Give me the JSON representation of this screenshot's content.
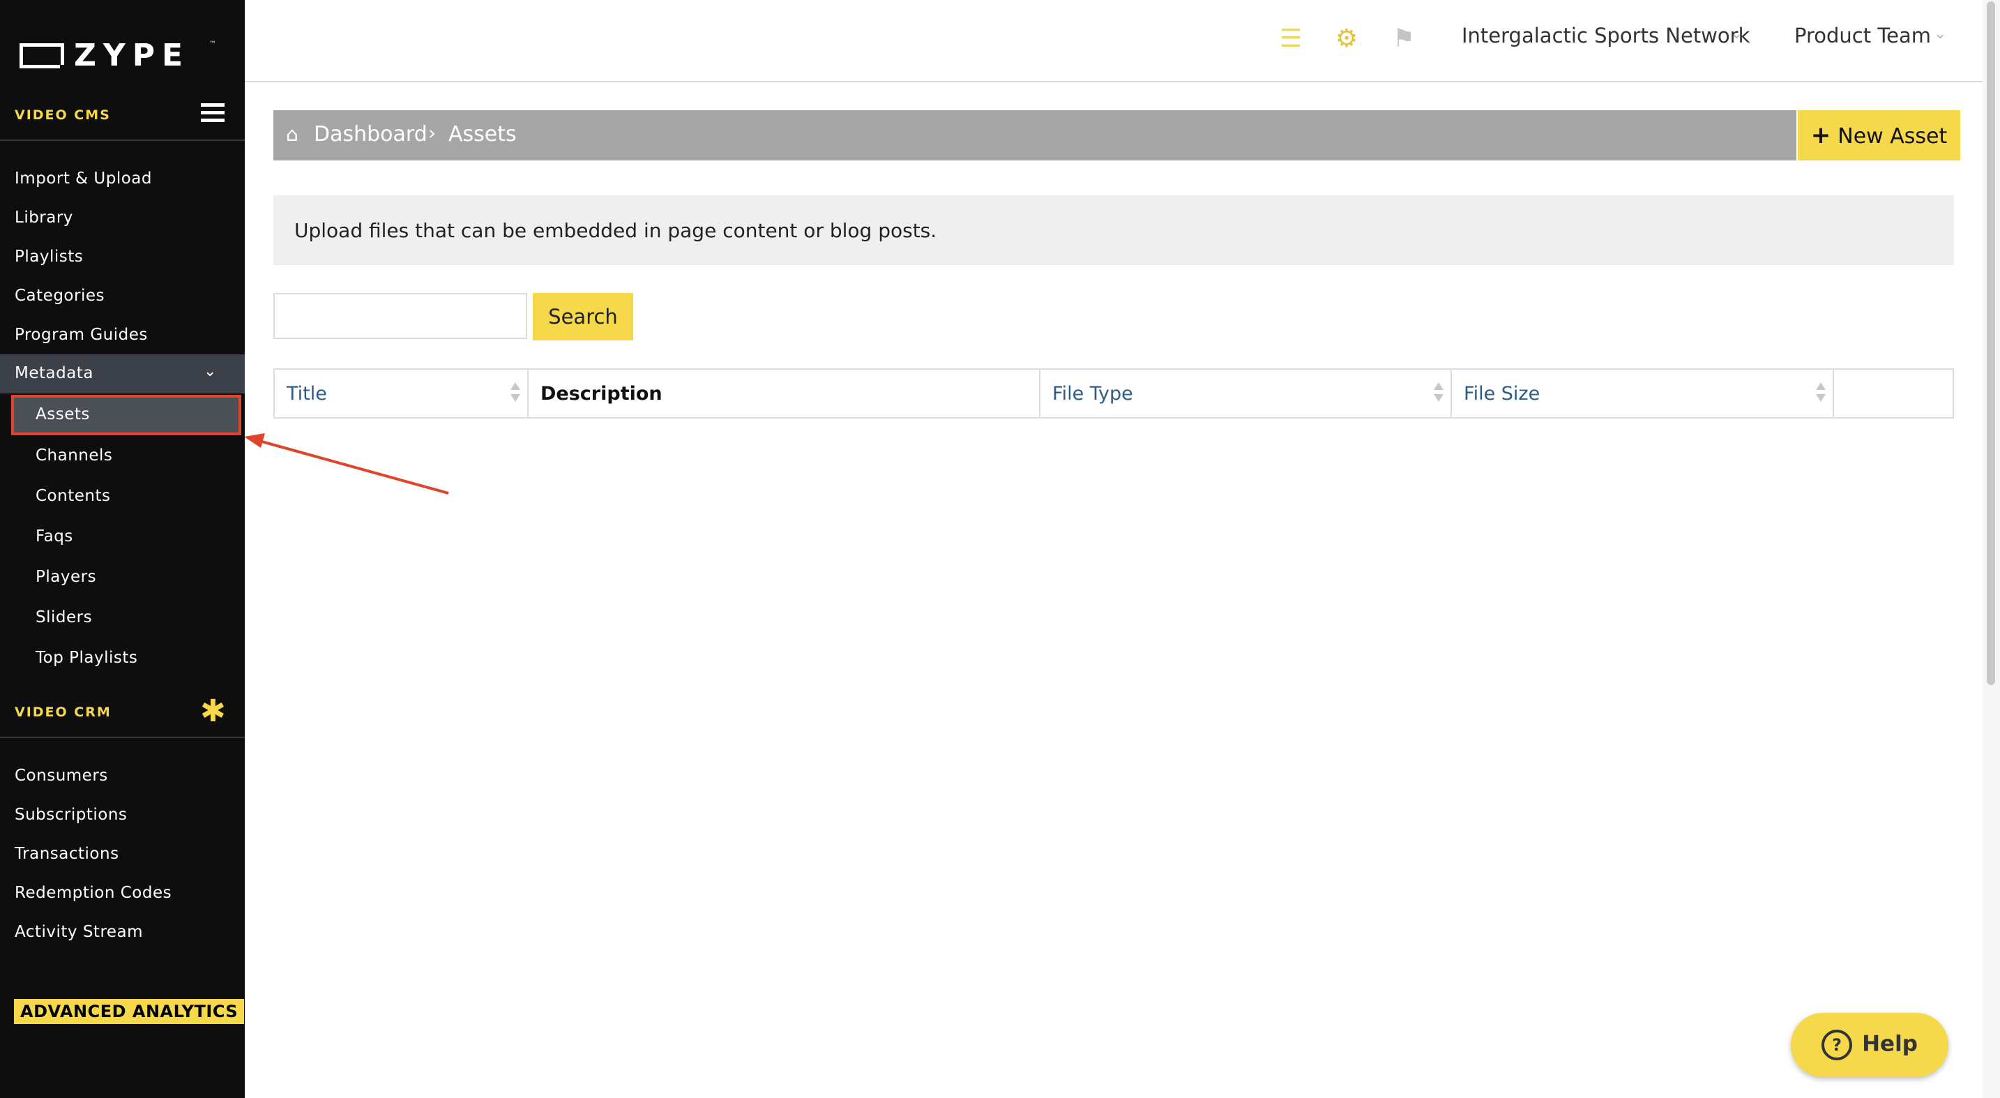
{
  "sidebar": {
    "logo": "ZYPE",
    "video_cms_title": "VIDEO CMS",
    "cms_items": [
      {
        "label": "Import & Upload"
      },
      {
        "label": "Library"
      },
      {
        "label": "Playlists"
      },
      {
        "label": "Categories"
      },
      {
        "label": "Program Guides"
      }
    ],
    "metadata_label": "Metadata",
    "metadata_items": [
      {
        "label": "Assets"
      },
      {
        "label": "Channels"
      },
      {
        "label": "Contents"
      },
      {
        "label": "Faqs"
      },
      {
        "label": "Players"
      },
      {
        "label": "Sliders"
      },
      {
        "label": "Top Playlists"
      }
    ],
    "video_crm_title": "VIDEO CRM",
    "crm_items": [
      {
        "label": "Consumers"
      },
      {
        "label": "Subscriptions"
      },
      {
        "label": "Transactions"
      },
      {
        "label": "Redemption Codes"
      },
      {
        "label": "Activity Stream"
      }
    ],
    "advanced_analytics": "ADVANCED ANALYTICS"
  },
  "header": {
    "org_name": "Intergalactic Sports Network",
    "team_name": "Product Team",
    "icons": [
      "stack-icon",
      "gears-icon",
      "chat-icon"
    ]
  },
  "breadcrumb": {
    "home": "Dashboard",
    "current": "Assets"
  },
  "new_asset_label": "New Asset",
  "info_text": "Upload files that can be embedded in page content or blog posts.",
  "search": {
    "button_label": "Search",
    "value": ""
  },
  "table": {
    "columns": [
      "Title",
      "Description",
      "File Type",
      "File Size",
      ""
    ]
  },
  "help_label": "Help",
  "colors": {
    "accent": "#f5d94a",
    "sidebar_bg": "#0e0e0e",
    "highlight_red": "#e0452b",
    "link_blue": "#2b5c8a"
  }
}
